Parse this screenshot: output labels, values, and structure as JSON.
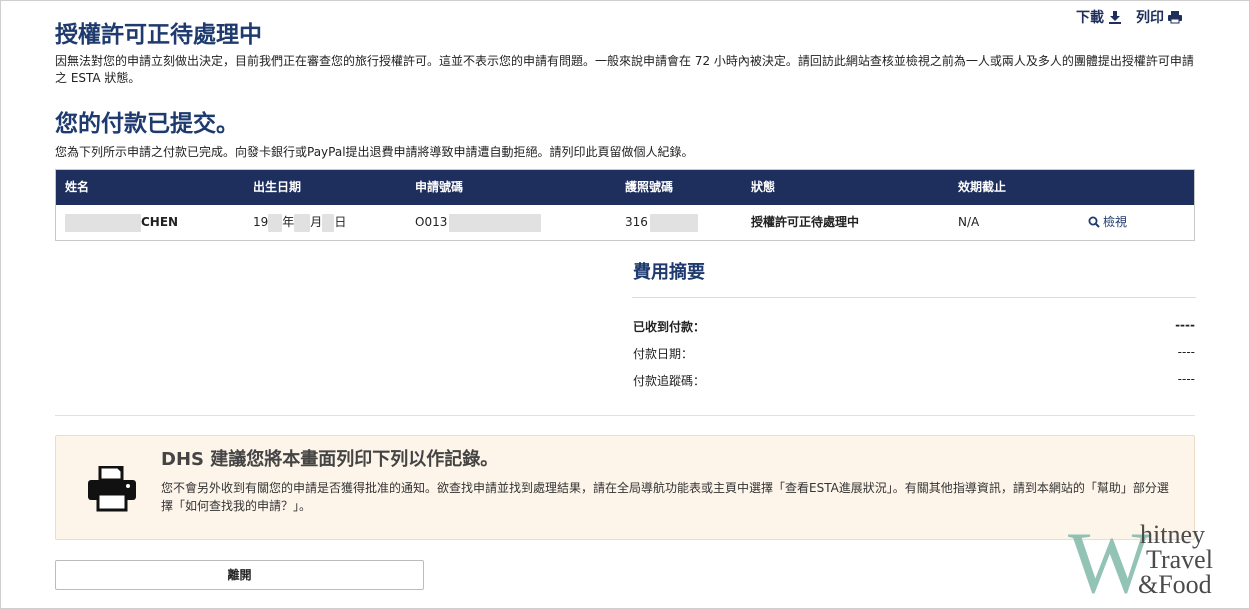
{
  "top_actions": {
    "download_label": "下載",
    "print_label": "列印"
  },
  "status": {
    "title": "授權許可正待處理中",
    "description": "因無法對您的申請立刻做出決定，目前我們正在審查您的旅行授權許可。這並不表示您的申請有問題。一般來說申請會在 72 小時內被決定。請回訪此網站查核並檢視之前為一人或兩人及多人的團體提出授權許可申請之 ESTA 狀態。"
  },
  "payment": {
    "title": "您的付款已提交。",
    "description": "您為下列所示申請之付款已完成。向發卡銀行或PayPal提出退費申請將導致申請遭自動拒絕。請列印此頁留做個人紀錄。"
  },
  "table": {
    "headers": [
      "姓名",
      "出生日期",
      "申請號碼",
      "護照號碼",
      "狀態",
      "效期截止",
      ""
    ],
    "row": {
      "name_visible": "CHEN",
      "dob_prefix": "19",
      "dob_year": "年",
      "dob_month": "月",
      "dob_day": "日",
      "application_prefix": "O013",
      "passport_prefix": "316",
      "status": "授權許可正待處理中",
      "expiry": "N/A",
      "view_label": "檢視"
    }
  },
  "fee_summary": {
    "title": "費用摘要",
    "rows": [
      {
        "label": "已收到付款：",
        "value": "----"
      },
      {
        "label": "付款日期：",
        "value": "----"
      },
      {
        "label": "付款追蹤碼：",
        "value": "----"
      }
    ]
  },
  "notice": {
    "title": "DHS 建議您將本畫面列印下列以作記錄。",
    "body": "您不會另外收到有關您的申請是否獲得批准的通知。欲查找申請並找到處理結果，請在全局導航功能表或主頁中選擇「查看ESTA進展狀況」。有關其他指導資訊，請到本網站的「幫助」部分選擇「如何查找我的申請？」。"
  },
  "leave_button": "離開",
  "watermark": {
    "letter": "W",
    "line1": "hitney",
    "line2": "Travel",
    "line3": "&Food"
  },
  "colors": {
    "navy": "#1e2f5e",
    "heading": "#1e3a6e",
    "notice_bg": "#fdf4ea",
    "watermark_green": "#7fb9a9"
  }
}
